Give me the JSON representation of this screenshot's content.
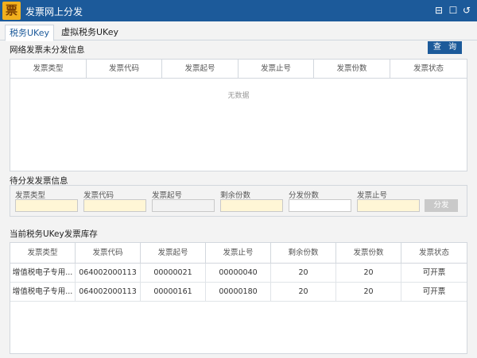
{
  "window": {
    "title": "发票网上分发",
    "logo_glyph": "票",
    "controls": [
      "⊟",
      "☐",
      "↺"
    ],
    "accent": "#1c5a9a"
  },
  "tabs": [
    {
      "label": "税务UKey",
      "active": true
    },
    {
      "label": "虚拟税务UKey",
      "active": false
    }
  ],
  "network_section": {
    "title": "网络发票未分发信息",
    "query_label": "查 询",
    "columns": [
      "发票类型",
      "发票代码",
      "发票起号",
      "发票止号",
      "发票份数",
      "发票状态"
    ],
    "empty_text": "无数据"
  },
  "pending_section": {
    "title": "待分发发票信息",
    "fields": [
      {
        "label": "发票类型",
        "value": "",
        "style": "yellow"
      },
      {
        "label": "发票代码",
        "value": "",
        "style": "yellow"
      },
      {
        "label": "发票起号",
        "value": "",
        "style": "grey"
      },
      {
        "label": "剩余份数",
        "value": "",
        "style": "yellow"
      },
      {
        "label": "分发份数",
        "value": "",
        "style": "white"
      },
      {
        "label": "发票止号",
        "value": "",
        "style": "yellow"
      }
    ],
    "distribute_label": "分发"
  },
  "inventory_section": {
    "title": "当前税务UKey发票库存",
    "columns": [
      "发票类型",
      "发票代码",
      "发票起号",
      "发票止号",
      "剩余份数",
      "发票份数",
      "发票状态"
    ],
    "rows": [
      [
        "增值税电子专用...",
        "064002000113",
        "00000021",
        "00000040",
        "20",
        "20",
        "可开票"
      ],
      [
        "增值税电子专用...",
        "064002000113",
        "00000161",
        "00000180",
        "20",
        "20",
        "可开票"
      ]
    ]
  }
}
